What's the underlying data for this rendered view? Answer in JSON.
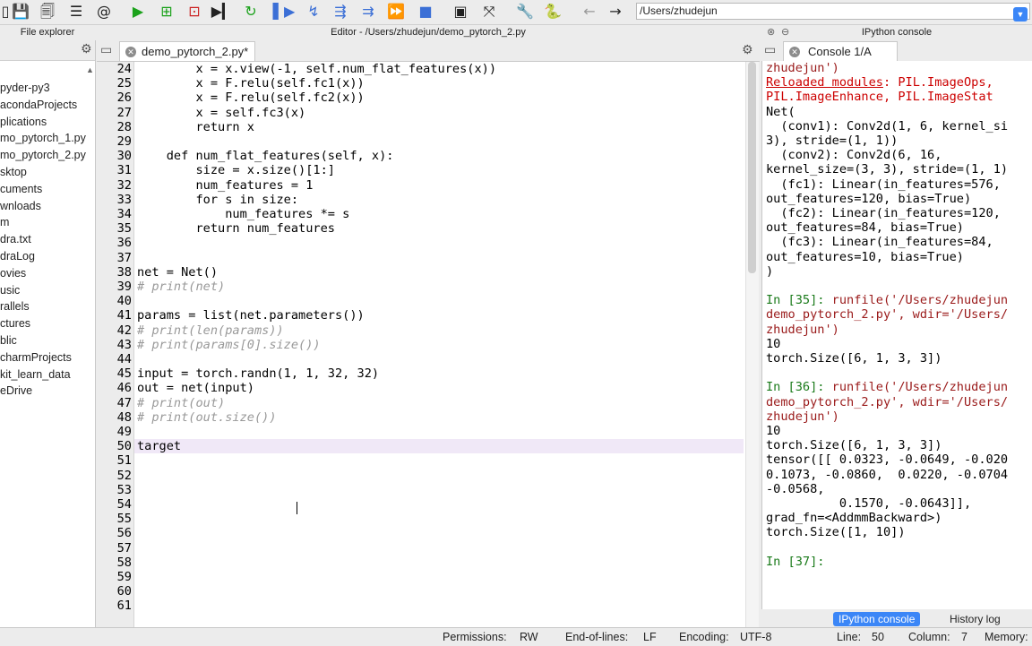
{
  "toolbar": {
    "icons": [
      "new-file",
      "save",
      "save-all",
      "open-list",
      "email-at",
      "run",
      "run-cell",
      "run-cell-advance",
      "run-selection",
      "rerun",
      "debug-step",
      "step-into",
      "step-over",
      "step-out",
      "continue",
      "stop",
      "maximize",
      "fullscreen",
      "settings-wrench",
      "python-path",
      "back",
      "forward"
    ],
    "path": "/Users/zhudejun"
  },
  "file_explorer": {
    "title": "File explorer",
    "items": [
      "pyder-py3",
      "acondaProjects",
      "plications",
      "mo_pytorch_1.py",
      "mo_pytorch_2.py",
      "sktop",
      "cuments",
      "wnloads",
      "m",
      "dra.txt",
      "draLog",
      "ovies",
      "usic",
      "rallels",
      "ctures",
      "blic",
      "charmProjects",
      "kit_learn_data",
      "eDrive"
    ]
  },
  "editor": {
    "title": "Editor - /Users/zhudejun/demo_pytorch_2.py",
    "tab_label": "demo_pytorch_2.py*",
    "line_numbers": [
      "24",
      "25",
      "26",
      "27",
      "28",
      "29",
      "30",
      "31",
      "32",
      "33",
      "34",
      "35",
      "36",
      "37",
      "38",
      "39",
      "40",
      "41",
      "42",
      "43",
      "44",
      "45",
      "46",
      "47",
      "48",
      "49",
      "50",
      "51",
      "52",
      "53",
      "54",
      "55",
      "56",
      "57",
      "58",
      "59",
      "60",
      "61"
    ],
    "lines": [
      "        x = x.view(-1, self.num_flat_features(x))",
      "        x = F.relu(self.fc1(x))",
      "        x = F.relu(self.fc2(x))",
      "        x = self.fc3(x)",
      "        return x",
      "",
      "    def num_flat_features(self, x):",
      "        size = x.size()[1:]",
      "        num_features = 1",
      "        for s in size:",
      "            num_features *= s",
      "        return num_features",
      "",
      "",
      "net = Net()",
      "# print(net)",
      "",
      "params = list(net.parameters())",
      "# print(len(params))",
      "# print(params[0].size())",
      "",
      "input = torch.randn(1, 1, 32, 32)",
      "out = net(input)",
      "# print(out)",
      "# print(out.size())",
      "",
      "target",
      "",
      "",
      "",
      "",
      "",
      "",
      "",
      "",
      "",
      "",
      ""
    ]
  },
  "console": {
    "title": "IPython console",
    "tab_label": "Console 1/A",
    "lines": [
      {
        "t": "zhudejun')",
        "c": "cstr"
      },
      {
        "t": "Reloaded modules",
        "c": "ulred",
        "rest": ": PIL.ImageOps,"
      },
      {
        "t": "PIL.ImageEnhance, PIL.ImageStat",
        "c": "cred"
      },
      {
        "t": "Net(",
        "c": ""
      },
      {
        "t": "  (conv1): Conv2d(1, 6, kernel_si",
        "c": ""
      },
      {
        "t": "3), stride=(1, 1))",
        "c": ""
      },
      {
        "t": "  (conv2): Conv2d(6, 16,",
        "c": ""
      },
      {
        "t": "kernel_size=(3, 3), stride=(1, 1)",
        "c": ""
      },
      {
        "t": "  (fc1): Linear(in_features=576,",
        "c": ""
      },
      {
        "t": "out_features=120, bias=True)",
        "c": ""
      },
      {
        "t": "  (fc2): Linear(in_features=120,",
        "c": ""
      },
      {
        "t": "out_features=84, bias=True)",
        "c": ""
      },
      {
        "t": "  (fc3): Linear(in_features=84,",
        "c": ""
      },
      {
        "t": "out_features=10, bias=True)",
        "c": ""
      },
      {
        "t": ")",
        "c": ""
      },
      {
        "t": "",
        "c": ""
      },
      {
        "t": "In [35]:",
        "c": "cgreen",
        "rest": " runfile('/Users/zhudejun"
      },
      {
        "t": "demo_pytorch_2.py', wdir='/Users/",
        "c": "cstr"
      },
      {
        "t": "zhudejun')",
        "c": "cstr"
      },
      {
        "t": "10",
        "c": ""
      },
      {
        "t": "torch.Size([6, 1, 3, 3])",
        "c": ""
      },
      {
        "t": "",
        "c": ""
      },
      {
        "t": "In [36]:",
        "c": "cgreen",
        "rest": " runfile('/Users/zhudejun"
      },
      {
        "t": "demo_pytorch_2.py', wdir='/Users/",
        "c": "cstr"
      },
      {
        "t": "zhudejun')",
        "c": "cstr"
      },
      {
        "t": "10",
        "c": ""
      },
      {
        "t": "torch.Size([6, 1, 3, 3])",
        "c": ""
      },
      {
        "t": "tensor([[ 0.0323, -0.0649, -0.020",
        "c": ""
      },
      {
        "t": "0.1073, -0.0860,  0.0220, -0.0704",
        "c": ""
      },
      {
        "t": "-0.0568,",
        "c": ""
      },
      {
        "t": "          0.1570, -0.0643]],",
        "c": ""
      },
      {
        "t": "grad_fn=<AddmmBackward>)",
        "c": ""
      },
      {
        "t": "torch.Size([1, 10])",
        "c": ""
      },
      {
        "t": "",
        "c": ""
      },
      {
        "t": "In [37]:",
        "c": "cgreen",
        "rest": ""
      }
    ],
    "bottom_tabs": [
      "IPython console",
      "History log"
    ]
  },
  "statusbar": {
    "permissions_label": "Permissions:",
    "permissions_value": "RW",
    "eol_label": "End-of-lines:",
    "eol_value": "LF",
    "encoding_label": "Encoding:",
    "encoding_value": "UTF-8",
    "line_label": "Line:",
    "line_value": "50",
    "column_label": "Column:",
    "column_value": "7",
    "memory_label": "Memory:"
  }
}
